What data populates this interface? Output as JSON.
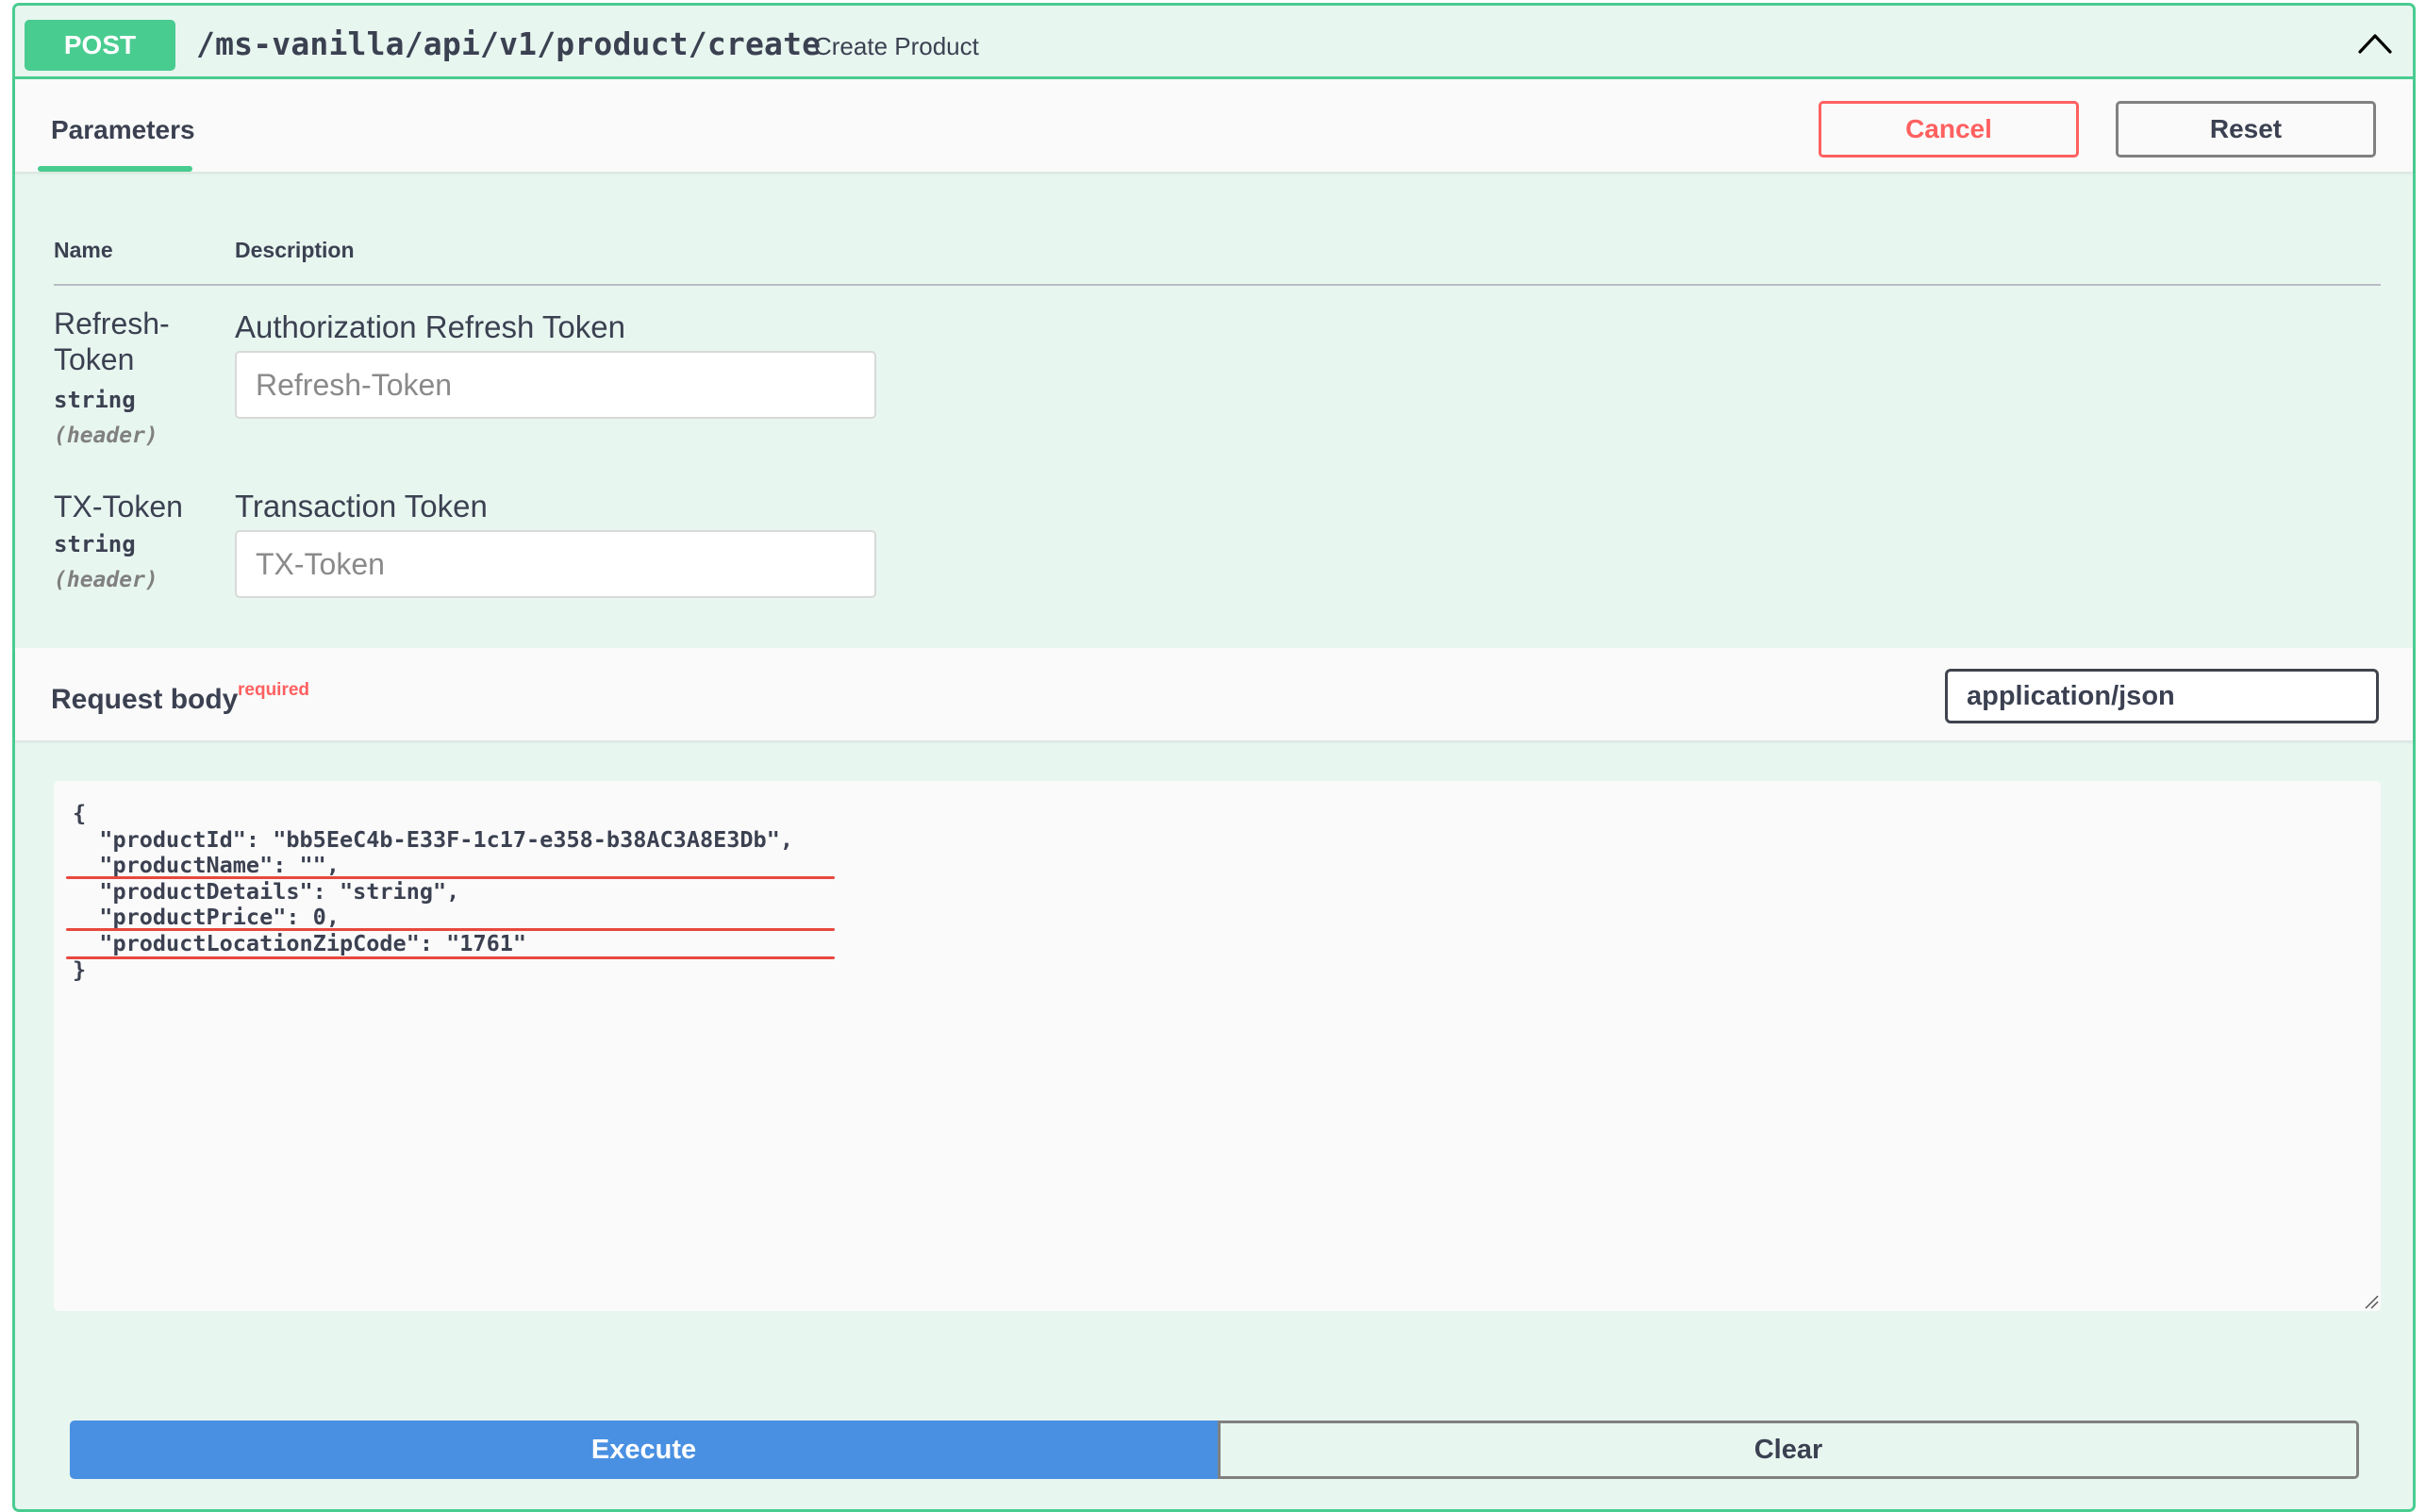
{
  "operation": {
    "method": "POST",
    "path": "/ms-vanilla/api/v1/product/create",
    "summary": "Create Product",
    "collapse_icon": "chevron-up-icon"
  },
  "parameters_section": {
    "tab_label": "Parameters",
    "cancel_label": "Cancel",
    "reset_label": "Reset",
    "columns": {
      "name": "Name",
      "description": "Description"
    },
    "params": [
      {
        "name_line1": "Refresh-",
        "name_line2": "Token",
        "type": "string",
        "in": "(header)",
        "description": "Authorization Refresh Token",
        "placeholder": "Refresh-Token",
        "value": ""
      },
      {
        "name_line1": "TX-Token",
        "type": "string",
        "in": "(header)",
        "description": "Transaction Token",
        "placeholder": "TX-Token",
        "value": ""
      }
    ]
  },
  "request_body": {
    "label": "Request body",
    "required_label": "required",
    "content_type": "application/json",
    "code": "{\n  \"productId\": \"bb5EeC4b-E33F-1c17-e358-b38AC3A8E3Db\",\n  \"productName\": \"\",\n  \"productDetails\": \"string\",\n  \"productPrice\": 0,\n  \"productLocationZipCode\": \"1761\"\n}"
  },
  "actions": {
    "execute_label": "Execute",
    "clear_label": "Clear"
  },
  "colors": {
    "post_green": "#49cc90",
    "block_background": "#e8f6f0",
    "cancel_red": "#ff6060",
    "execute_blue": "#4990e2",
    "annotation_red": "#e8483d"
  }
}
